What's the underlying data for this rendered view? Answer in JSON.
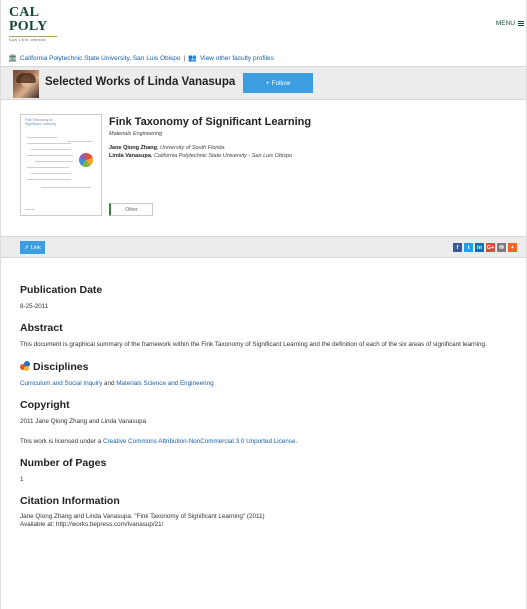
{
  "header": {
    "logo_main": "CAL POLY",
    "logo_sub": "SAN LUIS OBISPO",
    "menu_label": "MENU"
  },
  "breadcrumb": {
    "institution": "California Polytechnic State University, San Luis Obispo",
    "separator": "|",
    "other_profiles": "View other faculty profiles"
  },
  "profile": {
    "title": "Selected Works of Linda Vanasupa",
    "follow_label": "Follow"
  },
  "work": {
    "title": "Fink Taxonomy of Significant Learning",
    "department": "Materials Engineering",
    "authors": [
      {
        "name": "Jane Qiong Zhang",
        "affiliation": "University of South Florida"
      },
      {
        "name": "Linda Vanasupa",
        "affiliation": "California Polytechnic State University - San Luis Obispo"
      }
    ],
    "thumbnail_title": "Fink Taxonomy of Significant Learning",
    "type_tab": "Other"
  },
  "actions": {
    "link_label": "Link",
    "share_icons": [
      "facebook-icon",
      "twitter-icon",
      "linkedin-icon",
      "google-plus-icon",
      "email-icon",
      "more-icon"
    ],
    "share_glyphs": [
      "f",
      "t",
      "in",
      "G+",
      "✉",
      "+"
    ],
    "share_colors": [
      "#3b5998",
      "#1da1f2",
      "#0077b5",
      "#dd4b39",
      "#7d7d7d",
      "#f26522"
    ]
  },
  "sections": {
    "pub_date_title": "Publication Date",
    "pub_date": "8-25-2011",
    "abstract_title": "Abstract",
    "abstract": "This document is graphical summary of the framework within the Fink Taxonomy of Significant Learning and the definition of each of the six areas of significant learning.",
    "disciplines_title": "Disciplines",
    "discipline_1": "Curriculum and Social Inquiry",
    "discipline_joiner": "and",
    "discipline_2": "Materials Science and Engineering",
    "copyright_title": "Copyright",
    "copyright": "2011 Jane Qiong Zhang and Linda Vanasupa",
    "license_prefix": "This work is licensed under a",
    "license_link": "Creative Commons Attribution-NonCommercial 3.0 Unported License.",
    "pages_title": "Number of Pages",
    "pages": "1",
    "citation_title": "Citation Information",
    "citation": "Jane Qiong Zhang and Linda Vanasupa. \"Fink Taxonomy of Significant Learning\" (2011)",
    "available_at": "Available at: http://works.bepress.com/lvanasup/21/"
  }
}
